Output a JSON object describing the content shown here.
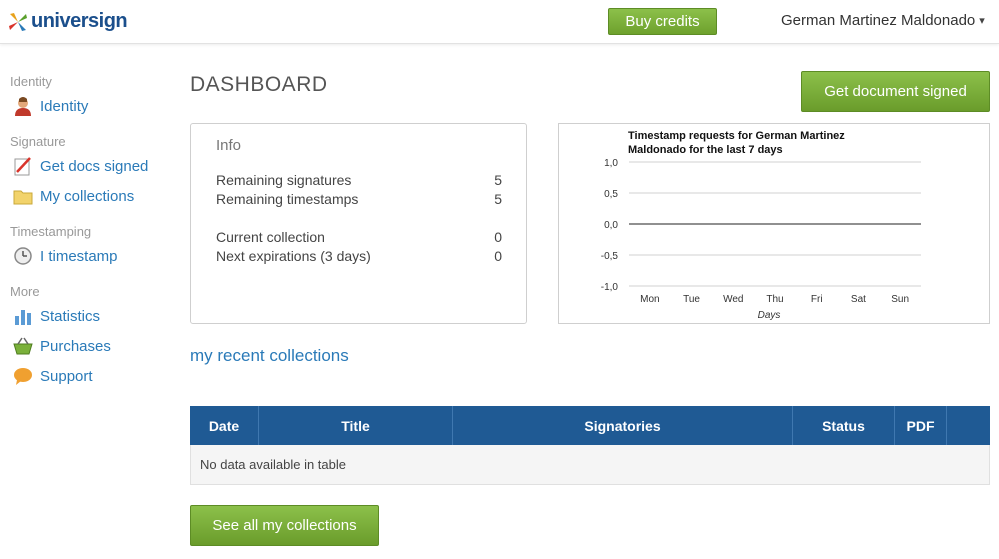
{
  "header": {
    "logo_text": "universign",
    "buy_credits_label": "Buy credits",
    "user_name": "German Martinez Maldonado",
    "user_caret": "▾"
  },
  "sidebar": {
    "sections": [
      {
        "title": "Identity",
        "items": [
          {
            "label": "Identity",
            "icon": "user-icon"
          }
        ]
      },
      {
        "title": "Signature",
        "items": [
          {
            "label": "Get docs signed",
            "icon": "pen-document-icon"
          },
          {
            "label": "My collections",
            "icon": "folder-icon"
          }
        ]
      },
      {
        "title": "Timestamping",
        "items": [
          {
            "label": "I timestamp",
            "icon": "clock-icon"
          }
        ]
      },
      {
        "title": "More",
        "items": [
          {
            "label": "Statistics",
            "icon": "bar-chart-icon"
          },
          {
            "label": "Purchases",
            "icon": "basket-icon"
          },
          {
            "label": "Support",
            "icon": "speech-bubble-icon"
          }
        ]
      }
    ]
  },
  "main": {
    "page_title": "DASHBOARD",
    "get_signed_label": "Get document signed",
    "info": {
      "title": "Info",
      "rows": [
        {
          "label": "Remaining signatures",
          "value": "5"
        },
        {
          "label": "Remaining timestamps",
          "value": "5"
        },
        {
          "label": "Current collection",
          "value": "0"
        },
        {
          "label": "Next expirations (3 days)",
          "value": "0"
        }
      ]
    },
    "recent_title": "my recent collections",
    "table": {
      "columns": [
        "Date",
        "Title",
        "Signatories",
        "Status",
        "PDF"
      ],
      "empty_text": "No data available in table"
    },
    "see_all_label": "See all my collections"
  },
  "chart_data": {
    "type": "line",
    "title": "Timestamp requests for German Martinez Maldonado for the last 7 days",
    "categories": [
      "Mon",
      "Tue",
      "Wed",
      "Thu",
      "Fri",
      "Sat",
      "Sun"
    ],
    "xlabel": "Days",
    "ylabel": "",
    "y_ticks": [
      "1,0",
      "0,5",
      "0,0",
      "-0,5",
      "-1,0"
    ],
    "ylim": [
      -1.0,
      1.0
    ],
    "series": [
      {
        "values": [
          0,
          0,
          0,
          0,
          0,
          0,
          0
        ]
      }
    ],
    "grid": true,
    "colors": {
      "grid": "#d0d0d0",
      "zero_line": "#222222"
    }
  },
  "colors": {
    "accent_green": "#7ab03a",
    "link_blue": "#2a7ab8",
    "table_header": "#1f5a94",
    "logo_blue": "#1b4f8c"
  }
}
